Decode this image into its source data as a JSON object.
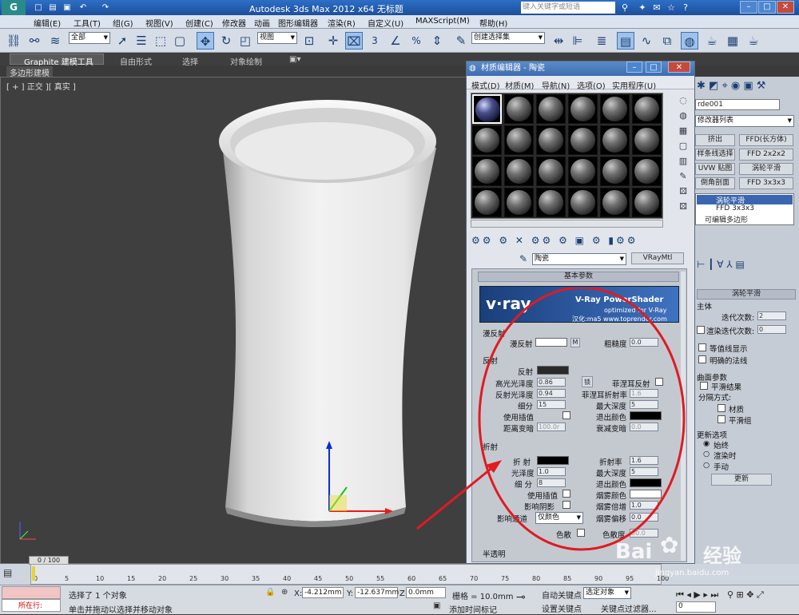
{
  "app": {
    "logo": "G",
    "title": "Autodesk 3ds Max  2012 x64    无标题",
    "search_placeholder": "键入关键字或短语"
  },
  "menubar": [
    "编辑(E)",
    "工具(T)",
    "组(G)",
    "视图(V)",
    "创建(C)",
    "修改器",
    "动画",
    "图形编辑器",
    "渲染(R)",
    "自定义(U)",
    "MAXScript(M)",
    "帮助(H)"
  ],
  "toolbar": {
    "filter": "全部",
    "view": "视图",
    "selection_set": "创建选择集",
    "numbers": [
      "3",
      "%"
    ]
  },
  "ribbon": {
    "tabs": [
      "Graphite 建模工具",
      "自由形式",
      "选择",
      "对象绘制"
    ],
    "sub": "多边形建模"
  },
  "viewport": {
    "label": "[ + ] 正交 ][ 真实 ]"
  },
  "material_editor": {
    "title": "材质编辑器 - 陶瓷",
    "menu": [
      "模式(D)",
      "材质(M)",
      "导航(N)",
      "选项(O)",
      "实用程序(U)"
    ],
    "material_name": "陶瓷",
    "material_type": "VRayMtl",
    "basic_params": "基本参数",
    "vray_banner": {
      "logo": "v·ray",
      "title": "V-Ray PowerShader",
      "sub": "optimized for V-Ray",
      "credit": "汉化:ma5 www.toprender.com"
    },
    "diffuse": {
      "header": "漫反射",
      "label": "漫反射",
      "m": "M",
      "rough_label": "粗糙度",
      "rough_val": "0.0"
    },
    "reflection": {
      "header": "反射",
      "reflect": "反射",
      "hilight": "高光光泽度",
      "hilight_val": "0.86",
      "lock": "锁",
      "fresnel": "菲涅耳反射",
      "refl_gloss": "反射光泽度",
      "refl_gloss_val": "0.94",
      "fresnel_ior": "菲涅耳折射率",
      "fresnel_ior_val": "1.6",
      "subdivs": "细分",
      "subdivs_val": "15",
      "max_depth": "最大深度",
      "max_depth_val": "5",
      "use_interp": "使用插值",
      "exit_color": "退出颜色",
      "dim_dist": "距离变暗",
      "dim_dist_val": "100.0r",
      "dim_falloff": "衰减变暗",
      "dim_falloff_val": "0.0"
    },
    "refraction": {
      "header": "折射",
      "refract": "折 射",
      "ior": "折射率",
      "ior_val": "1.6",
      "gloss": "光泽度",
      "gloss_val": "1.0",
      "max_depth": "最大深度",
      "max_depth_val": "5",
      "subdivs": "细 分",
      "subdivs_val": "8",
      "exit_color": "退出颜色",
      "use_interp": "使用插值",
      "fog_color": "烟雾颜色",
      "affect_shadows": "影响阴影",
      "fog_mult": "烟雾倍增",
      "fog_mult_val": "1.0",
      "affect_channels": "影响通道",
      "channels_val": "仅颜色",
      "fog_bias": "烟雾偏移",
      "fog_bias_val": "0.0",
      "dispersion": "色散",
      "abbe": "色散度",
      "abbe_val": "50.0"
    },
    "translucency": "半透明"
  },
  "command_panel": {
    "object_name": "rde001",
    "modifier_list": "修改器列表",
    "buttons": [
      "挤出",
      "FFD(长方体)",
      "样条线选择",
      "FFD 2x2x2",
      "UVW 贴图",
      "涡轮平滑",
      "倒角剖面",
      "FFD 3x3x3"
    ],
    "stack": [
      "涡轮平滑",
      "FFD 3x3x3",
      "可编辑多边形"
    ],
    "rollout": "涡轮平滑",
    "main": "主体",
    "iterations": "迭代次数:",
    "iterations_val": "2",
    "render_iters": "渲染迭代次数:",
    "render_iters_val": "0",
    "isoline": "等值线显示",
    "explicit_normals": "明确的法线",
    "surface": "曲面参数",
    "smooth_result": "平滑结果",
    "separate": "分隔方式:",
    "materials": "材质",
    "smoothing_groups": "平滑组",
    "update": "更新选项",
    "always": "始终",
    "when_render": "渲染时",
    "manual": "手动",
    "update_btn": "更新"
  },
  "timeline": {
    "frame": "0 / 100",
    "ticks": [
      "0",
      "5",
      "10",
      "15",
      "20",
      "25",
      "30",
      "35",
      "40",
      "45",
      "50",
      "55",
      "60",
      "65",
      "70",
      "75",
      "80",
      "85",
      "90",
      "95",
      "100"
    ]
  },
  "status": {
    "script_label": "所在行:",
    "selected": "选择了 1 个对象",
    "hint": "单击并拖动以选择并移动对象",
    "x": "-4.212mm",
    "y": "-12.637mm",
    "z": "0.0mm",
    "grid": "栅格 = 10.0mm",
    "auto_key": "自动关键点",
    "sel_obj": "选定对象",
    "set_key": "设置关键点",
    "key_filter": "关键点过滤器...",
    "add_time_tag": "添加时间标记",
    "frame_num": "0"
  },
  "watermark": {
    "brand": "Bai",
    "brand2": "经验",
    "url": "jingyan.baidu.com"
  }
}
